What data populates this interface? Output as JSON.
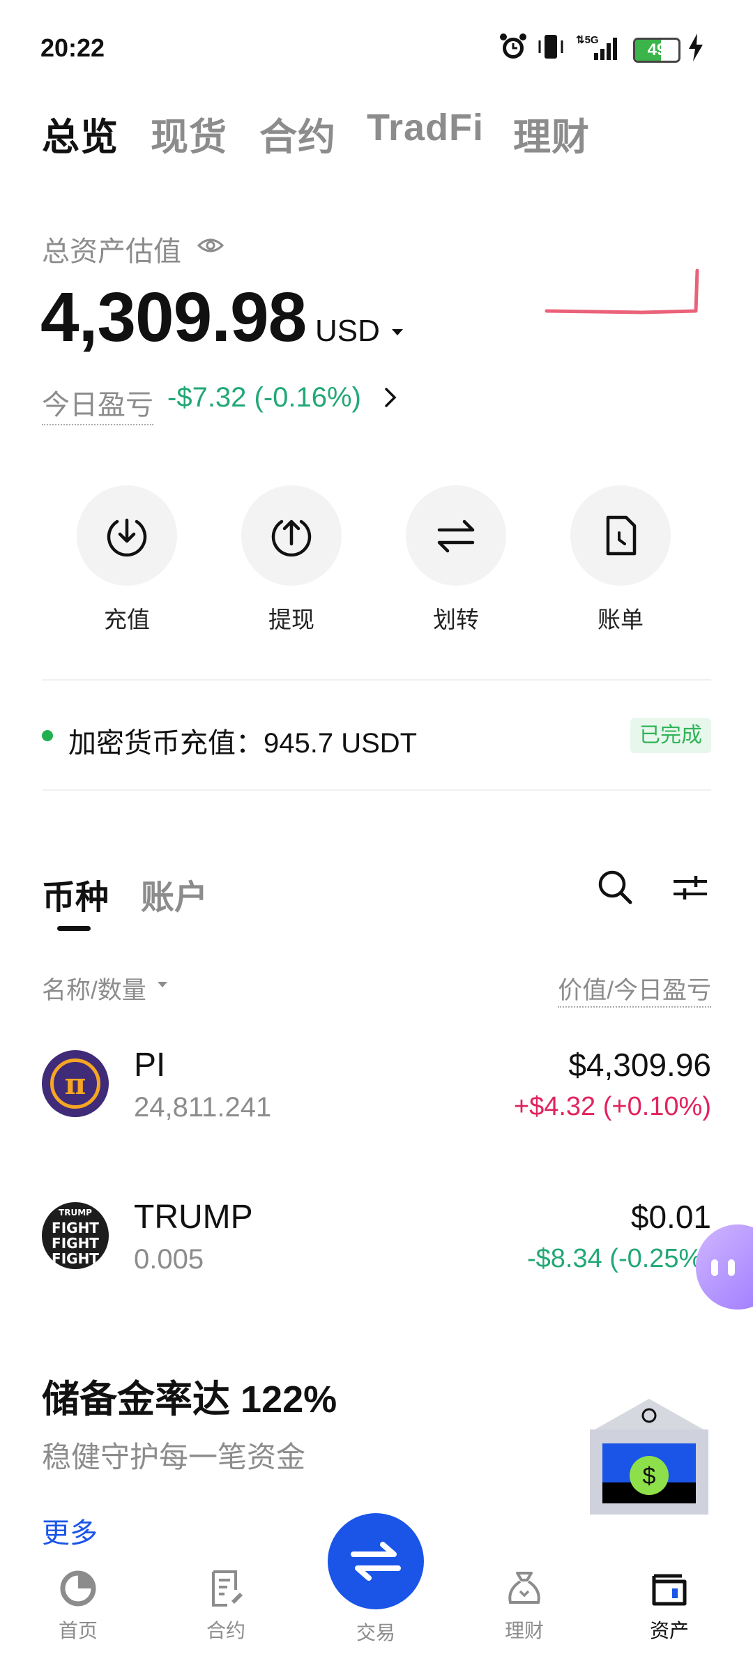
{
  "status_bar": {
    "time": "20:22",
    "network": "5G",
    "battery": "49"
  },
  "top_tabs": [
    {
      "label": "总览",
      "active": true
    },
    {
      "label": "现货",
      "active": false
    },
    {
      "label": "合约",
      "active": false
    },
    {
      "label": "TradFi",
      "active": false
    },
    {
      "label": "理财",
      "active": false
    }
  ],
  "overview": {
    "label": "总资产估值",
    "value": "4,309.98",
    "currency": "USD",
    "pnl_label": "今日盈亏",
    "pnl_value": "-$7.32 (-0.16%)"
  },
  "actions": [
    {
      "label": "充值",
      "icon": "deposit-icon"
    },
    {
      "label": "提现",
      "icon": "withdraw-icon"
    },
    {
      "label": "划转",
      "icon": "transfer-icon"
    },
    {
      "label": "账单",
      "icon": "bill-icon"
    }
  ],
  "deposit_notice": {
    "text": "加密货币充值：945.7 USDT",
    "status": "已完成"
  },
  "asset_tabs": [
    {
      "label": "币种",
      "active": true
    },
    {
      "label": "账户",
      "active": false
    }
  ],
  "columns": {
    "name": "名称/数量",
    "value": "价值/今日盈亏"
  },
  "coins": [
    {
      "symbol": "PI",
      "quantity": "24,811.241",
      "value": "$4,309.96",
      "pnl": "+$4.32 (+0.10%)",
      "pnl_color": "#e0245e"
    },
    {
      "symbol": "TRUMP",
      "quantity": "0.005",
      "value": "$0.01",
      "pnl": "-$8.34 (-0.25%)",
      "pnl_color": "#22a876"
    }
  ],
  "trump_logo_text": [
    "TRUMP",
    "FIGHT",
    "FIGHT",
    "FIGHT"
  ],
  "reserve": {
    "title": "储备金率达 122%",
    "subtitle": "稳健守护每一笔资金",
    "more": "更多"
  },
  "bottom_nav": [
    {
      "label": "首页",
      "active": false
    },
    {
      "label": "合约",
      "active": false
    },
    {
      "label": "交易",
      "active": false
    },
    {
      "label": "理财",
      "active": false
    },
    {
      "label": "资产",
      "active": true
    }
  ],
  "colors": {
    "accent": "#1a55e8",
    "gain": "#e0245e",
    "loss": "#22a876"
  }
}
